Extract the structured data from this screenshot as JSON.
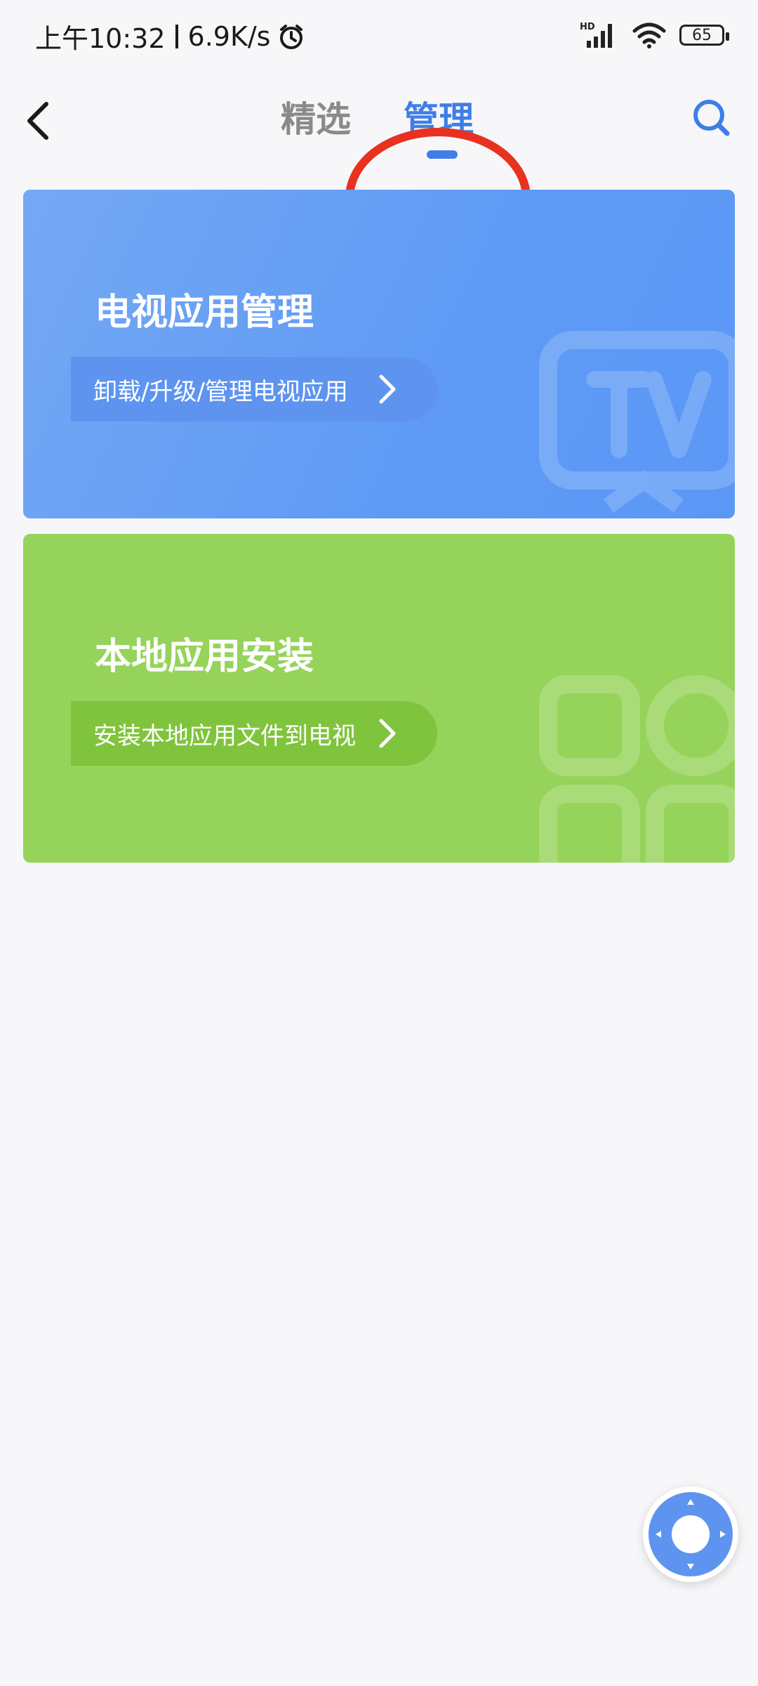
{
  "status_bar": {
    "time": "上午10:32",
    "speed": "6.9K/s",
    "network_badge": "HD",
    "battery": "65"
  },
  "header": {
    "back_icon": "chevron-left-icon",
    "tabs": [
      {
        "label": "精选",
        "active": false
      },
      {
        "label": "管理",
        "active": true
      }
    ],
    "search_icon": "search-icon",
    "accent": "#3f7ee8",
    "annotation_color": "#e8321f"
  },
  "cards": [
    {
      "title": "电视应用管理",
      "button_label": "卸载/升级/管理电视应用",
      "color": "#5e9af5",
      "bg_icon": "tv-icon"
    },
    {
      "title": "本地应用安装",
      "button_label": "安装本地应用文件到电视",
      "color": "#96d35a",
      "bg_icon": "apps-grid-icon"
    }
  ],
  "fab": {
    "icon": "remote-control-icon"
  }
}
